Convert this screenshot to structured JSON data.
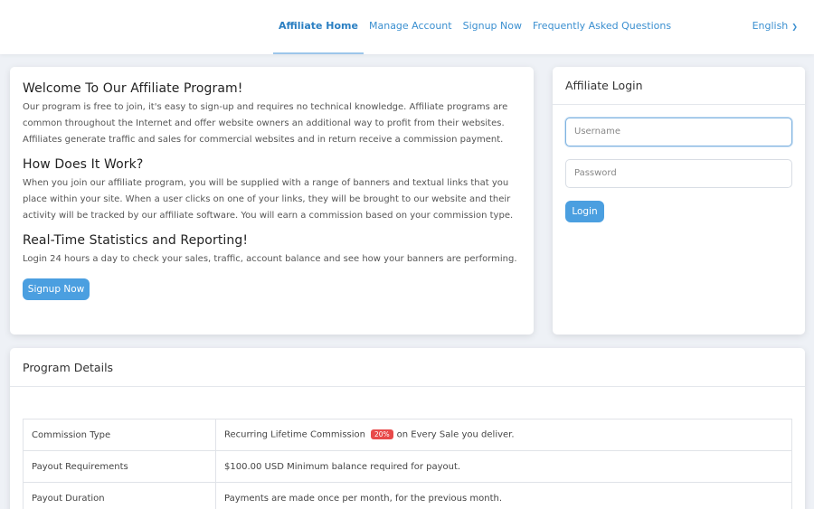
{
  "nav": {
    "items": [
      {
        "label": "Affiliate Home"
      },
      {
        "label": "Manage Account"
      },
      {
        "label": "Signup Now"
      },
      {
        "label": "Frequently Asked Questions"
      }
    ],
    "active": "Affiliate Home",
    "language": "English"
  },
  "welcome": {
    "sections": [
      {
        "heading": "Welcome To Our Affiliate Program!",
        "text": "Our program is free to join, it's easy to sign-up and requires no technical knowledge. Affiliate programs are common throughout the Internet and offer website owners an additional way to profit from their websites. Affiliates generate traffic and sales for commercial websites and in return receive a commission payment."
      },
      {
        "heading": "How Does It Work?",
        "text": "When you join our affiliate program, you will be supplied with a range of banners and textual links that you place within your site. When a user clicks on one of your links, they will be brought to our website and their activity will be tracked by our affiliate software. You will earn a commission based on your commission type."
      },
      {
        "heading": "Real-Time Statistics and Reporting!",
        "text": "Login 24 hours a day to check your sales, traffic, account balance and see how your banners are performing."
      }
    ],
    "signup_button": "Signup Now"
  },
  "login": {
    "title": "Affiliate Login",
    "username_placeholder": "Username",
    "password_placeholder": "Password",
    "button": "Login"
  },
  "details": {
    "title": "Program Details",
    "rows": [
      {
        "key": "Commission Type",
        "value_pre": "Recurring Lifetime Commission",
        "badge": "20%",
        "value_post": "on Every Sale you deliver."
      },
      {
        "key": "Payout Requirements",
        "value_pre": "$100.00 USD Minimum balance required for payout.",
        "badge": "",
        "value_post": ""
      },
      {
        "key": "Payout Duration",
        "value_pre": "Payments are made once per month, for the previous month.",
        "badge": "",
        "value_post": ""
      }
    ]
  },
  "colors": {
    "accent": "#4b9fe0",
    "badge": "#e84a4a",
    "background": "#eef1f6"
  }
}
